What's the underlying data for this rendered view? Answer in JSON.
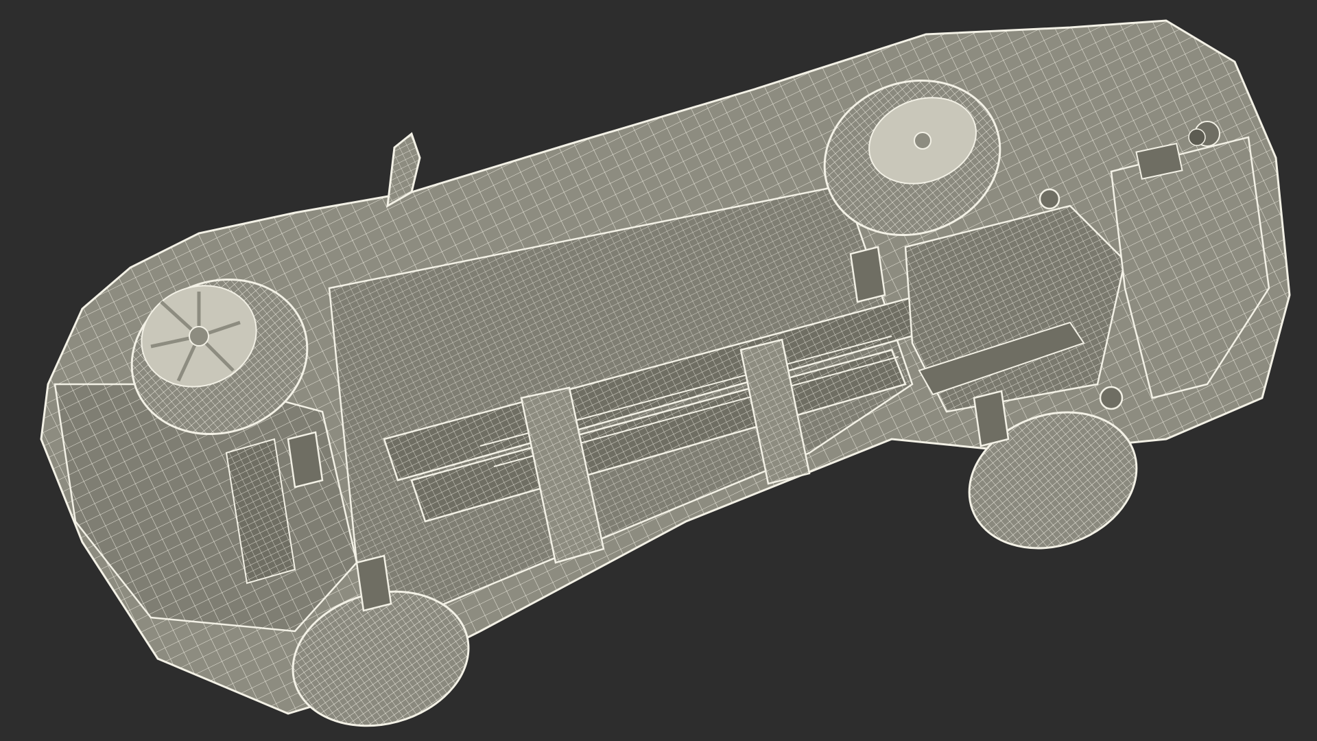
{
  "scene": {
    "subject": "car-underside-wireframe",
    "background_color": "#2d2d2d",
    "shell_color": "#8d8c80",
    "shell_dark_color": "#6f6e63",
    "wire_color": "#f3f1e6",
    "tire_color": "#8a897e",
    "rim_color": "#c9c7ba"
  }
}
